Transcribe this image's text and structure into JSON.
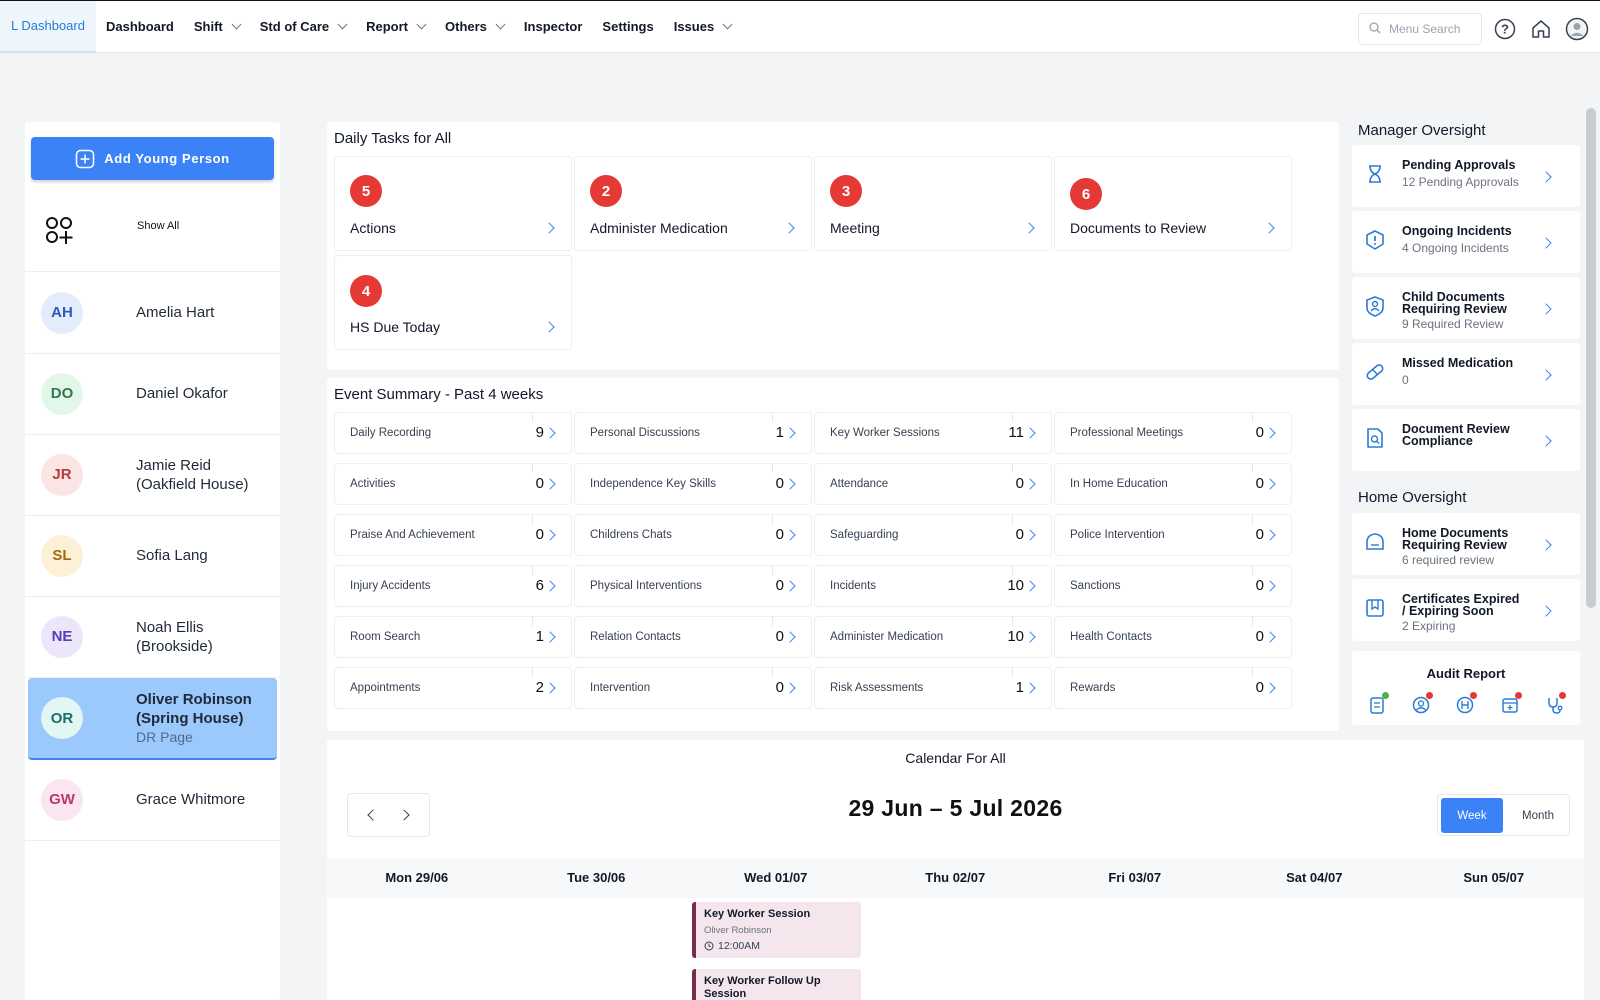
{
  "nav": {
    "active": "L Dashboard",
    "items": [
      {
        "label": "Dashboard",
        "dropdown": false
      },
      {
        "label": "Shift",
        "dropdown": true
      },
      {
        "label": "Std of Care",
        "dropdown": true
      },
      {
        "label": "Report",
        "dropdown": true
      },
      {
        "label": "Others",
        "dropdown": true
      },
      {
        "label": "Inspector",
        "dropdown": false
      },
      {
        "label": "Settings",
        "dropdown": false
      },
      {
        "label": "Issues",
        "dropdown": true
      }
    ],
    "search_placeholder": "Menu Search"
  },
  "people": {
    "add_label": "Add Young Person",
    "show_all": "Show All",
    "list": [
      {
        "initials": "AH",
        "name": "Amelia Hart",
        "bg": "#e3ecfb",
        "fg": "#2b5cb8"
      },
      {
        "initials": "DO",
        "name": "Daniel Okafor",
        "bg": "#e3f6ea",
        "fg": "#2d7a48"
      },
      {
        "initials": "JR",
        "name": "Jamie Reid (Oakfield House)",
        "bg": "#fbe4e4",
        "fg": "#b83a3a"
      },
      {
        "initials": "SL",
        "name": "Sofia Lang",
        "bg": "#fcf1d6",
        "fg": "#a26a10"
      },
      {
        "initials": "NE",
        "name": "Noah Ellis (Brookside)",
        "bg": "#ece6fb",
        "fg": "#5b3bb8"
      },
      {
        "initials": "OR",
        "name": "Oliver Robinson (Spring House)",
        "bg": "#e2f6f4",
        "fg": "#1e6e6a",
        "sub": "DR Page",
        "selected": true
      },
      {
        "initials": "GW",
        "name": "Grace Whitmore",
        "bg": "#fbe6ef",
        "fg": "#b83a6d"
      }
    ]
  },
  "daily_tasks": {
    "title": "Daily Tasks for All",
    "cards": [
      {
        "count": "5",
        "label": "Actions"
      },
      {
        "count": "2",
        "label": "Administer Medication"
      },
      {
        "count": "3",
        "label": "Meeting"
      },
      {
        "count": "6",
        "label": "Documents to Review"
      },
      {
        "count": "4",
        "label": "HS Due Today"
      }
    ]
  },
  "event_summary": {
    "title": "Event Summary - Past 4 weeks",
    "cards": [
      {
        "label": "Daily Recording",
        "value": "9"
      },
      {
        "label": "Personal Discussions",
        "value": "1"
      },
      {
        "label": "Key Worker Sessions",
        "value": "11"
      },
      {
        "label": "Professional Meetings",
        "value": "0"
      },
      {
        "label": "Activities",
        "value": "0"
      },
      {
        "label": "Independence Key Skills",
        "value": "0"
      },
      {
        "label": "Attendance",
        "value": "0"
      },
      {
        "label": "In Home Education",
        "value": "0"
      },
      {
        "label": "Praise And Achievement",
        "value": "0"
      },
      {
        "label": "Childrens Chats",
        "value": "0"
      },
      {
        "label": "Safeguarding",
        "value": "0"
      },
      {
        "label": "Police Intervention",
        "value": "0"
      },
      {
        "label": "Injury Accidents",
        "value": "6"
      },
      {
        "label": "Physical Interventions",
        "value": "0"
      },
      {
        "label": "Incidents",
        "value": "10"
      },
      {
        "label": "Sanctions",
        "value": "0"
      },
      {
        "label": "Room Search",
        "value": "1"
      },
      {
        "label": "Relation Contacts",
        "value": "0"
      },
      {
        "label": "Administer Medication",
        "value": "10"
      },
      {
        "label": "Health Contacts",
        "value": "0"
      },
      {
        "label": "Appointments",
        "value": "2"
      },
      {
        "label": "Intervention",
        "value": "0"
      },
      {
        "label": "Risk Assessments",
        "value": "1"
      },
      {
        "label": "Rewards",
        "value": "0"
      }
    ]
  },
  "manager_oversight": {
    "title": "Manager Oversight",
    "items": [
      {
        "icon": "hourglass-icon",
        "head1": "Pending Approvals",
        "head2": "",
        "sub": "12 Pending Approvals"
      },
      {
        "icon": "alert-shield-icon",
        "head1": "Ongoing Incidents",
        "head2": "",
        "sub": "4 Ongoing Incidents"
      },
      {
        "icon": "child-badge-icon",
        "head1": "Child Documents",
        "head2": "Requiring Review",
        "sub": "9 Required Review"
      },
      {
        "icon": "pill-icon",
        "head1": "Missed Medication",
        "head2": "",
        "sub": "0"
      },
      {
        "icon": "document-search-icon",
        "head1": "Document Review",
        "head2": "Compliance",
        "sub": ""
      }
    ]
  },
  "home_oversight": {
    "title": "Home Oversight",
    "items": [
      {
        "icon": "home-doc-icon",
        "head1": "Home Documents",
        "head2": "Requiring Review",
        "sub": "6 required review"
      },
      {
        "icon": "certificate-icon",
        "head1": "Certificates Expired",
        "head2": "/ Expiring Soon",
        "sub": "2 Expiring"
      }
    ],
    "audit_title": "Audit Report",
    "audit_icons": [
      {
        "icon": "clipboard-audit-icon",
        "dot": "#4caf50"
      },
      {
        "icon": "user-circle-audit-icon",
        "dot": "#e53935"
      },
      {
        "icon": "health-audit-icon",
        "dot": "#e53935"
      },
      {
        "icon": "calendar-audit-icon",
        "dot": "#e53935"
      },
      {
        "icon": "stethoscope-audit-icon",
        "dot": "#e53935"
      }
    ]
  },
  "calendar": {
    "title": "Calendar For All",
    "range": "29 Jun – 5 Jul 2026",
    "week_label": "Week",
    "month_label": "Month",
    "days": [
      "Mon 29/06",
      "Tue 30/06",
      "Wed 01/07",
      "Thu 02/07",
      "Fri 03/07",
      "Sat 04/07",
      "Sun 05/07"
    ],
    "events": [
      {
        "title": "Key Worker Session",
        "person": "Oliver Robinson",
        "time": "12:00AM"
      },
      {
        "title": "Key Worker Follow Up Session",
        "person": "",
        "time": ""
      }
    ]
  },
  "colors": {
    "accent": "#3b82f6",
    "badge": "#e53935",
    "selected_person": "#9cc9fb",
    "event_border": "#7b2a52"
  }
}
